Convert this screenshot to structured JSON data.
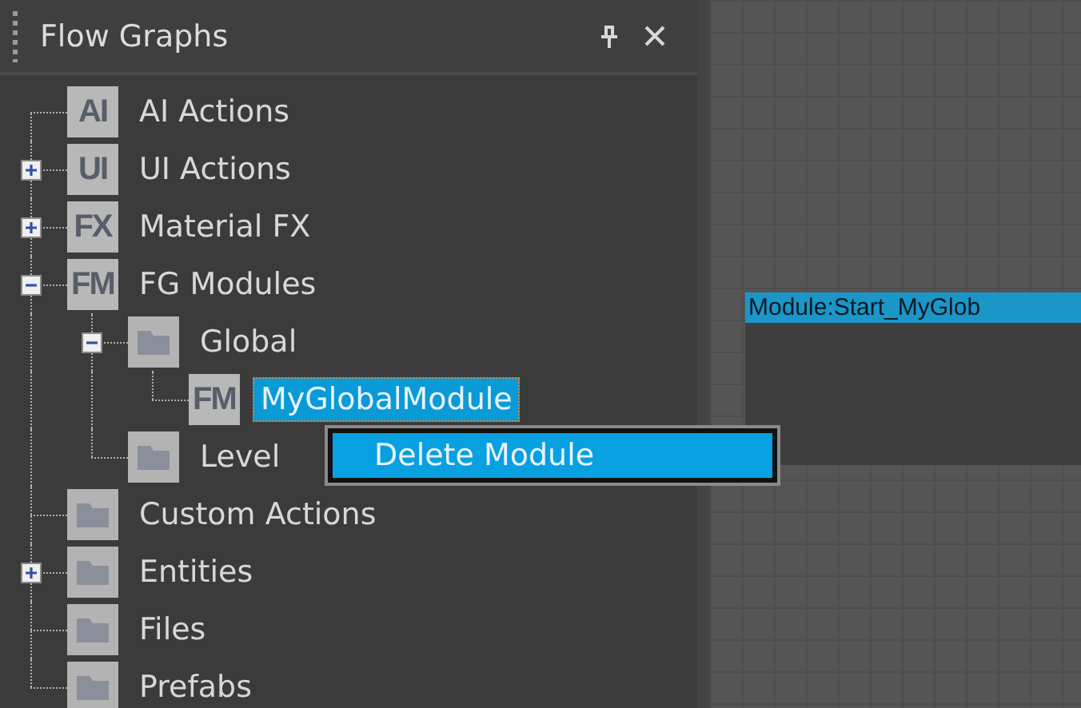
{
  "panel": {
    "title": "Flow Graphs"
  },
  "tree": [
    {
      "label": "AI Actions",
      "icon": {
        "kind": "badge",
        "text": "AI"
      },
      "selected": false
    },
    {
      "label": "UI Actions",
      "icon": {
        "kind": "badge",
        "text": "UI"
      },
      "expanded": false,
      "selected": false
    },
    {
      "label": "Material FX",
      "icon": {
        "kind": "badge",
        "text": "FX"
      },
      "expanded": false,
      "selected": false
    },
    {
      "label": "FG Modules",
      "icon": {
        "kind": "badge",
        "text": "FM"
      },
      "expanded": true,
      "selected": false,
      "children": [
        {
          "label": "Global",
          "icon": {
            "kind": "folder"
          },
          "expanded": true,
          "selected": false,
          "children": [
            {
              "label": "MyGlobalModule",
              "icon": {
                "kind": "badge",
                "text": "FM"
              },
              "selected": true
            }
          ]
        },
        {
          "label": "Level",
          "icon": {
            "kind": "folder"
          },
          "selected": false
        }
      ]
    },
    {
      "label": "Custom Actions",
      "icon": {
        "kind": "folder"
      },
      "selected": false
    },
    {
      "label": "Entities",
      "icon": {
        "kind": "folder"
      },
      "expanded": false,
      "selected": false
    },
    {
      "label": "Files",
      "icon": {
        "kind": "folder"
      },
      "selected": false
    },
    {
      "label": "Prefabs",
      "icon": {
        "kind": "folder"
      },
      "selected": false
    }
  ],
  "context_menu": {
    "items": [
      {
        "label": "Delete Module",
        "selected": true
      }
    ]
  },
  "canvas": {
    "node": {
      "title": "Module:Start_MyGlob"
    }
  }
}
